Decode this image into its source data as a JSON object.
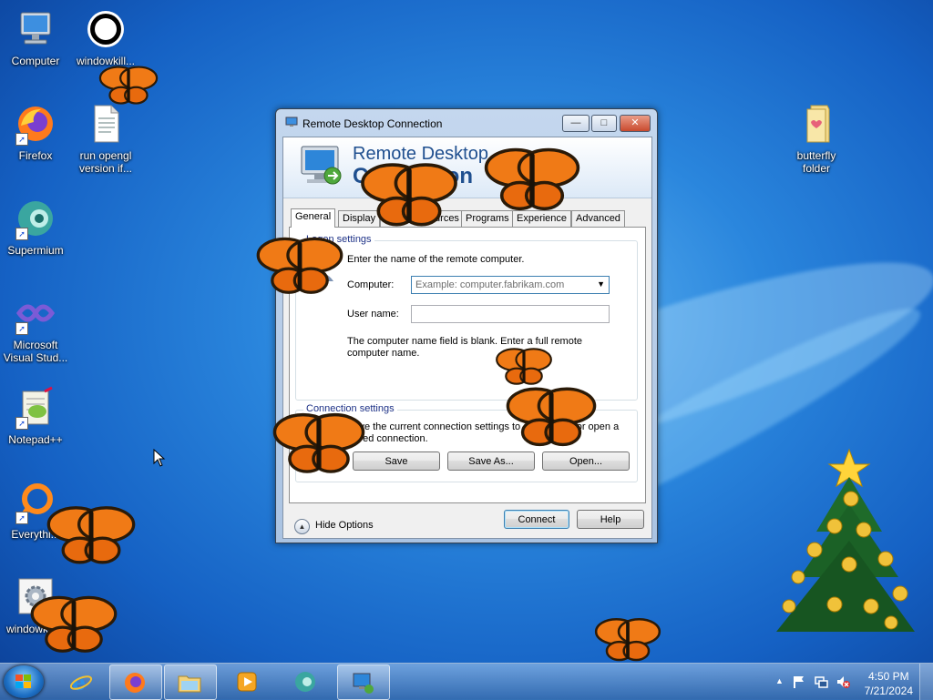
{
  "desktop": {
    "icons": [
      {
        "label": "Computer"
      },
      {
        "label": "windowkill..."
      },
      {
        "label": "Firefox"
      },
      {
        "label": "run opengl version if..."
      },
      {
        "label": "Supermium"
      },
      {
        "label": "Microsoft Visual Stud..."
      },
      {
        "label": "Notepad++"
      },
      {
        "label": "Everythi..."
      },
      {
        "label": "windowkill..."
      },
      {
        "label": "butterfly folder"
      }
    ]
  },
  "window": {
    "title": "Remote Desktop Connection",
    "banner_line1": "Remote Desktop",
    "banner_line2": "Connection",
    "tabs": [
      {
        "label": "General",
        "active": true
      },
      {
        "label": "Display"
      },
      {
        "label": "Local Resources"
      },
      {
        "label": "Programs"
      },
      {
        "label": "Experience"
      },
      {
        "label": "Advanced"
      }
    ],
    "logon": {
      "group_label": "Logon settings",
      "instruction": "Enter the name of the remote computer.",
      "computer_label": "Computer:",
      "computer_placeholder": "Example: computer.fabrikam.com",
      "username_label": "User name:",
      "username_value": "",
      "notice": "The computer name field is blank. Enter a full remote computer name."
    },
    "connection": {
      "group_label": "Connection settings",
      "text": "Save the current connection settings to an RDP file or open a saved connection.",
      "save": "Save",
      "save_as": "Save As...",
      "open": "Open..."
    },
    "hide_options": "Hide Options",
    "connect": "Connect",
    "help": "Help",
    "minimize_glyph": "—",
    "maximize_glyph": "□",
    "close_glyph": "✕"
  },
  "taskbar": {
    "items": [
      {
        "name": "Internet Explorer"
      },
      {
        "name": "Firefox"
      },
      {
        "name": "Windows Explorer"
      },
      {
        "name": "Windows Media Player"
      },
      {
        "name": "Supermium"
      },
      {
        "name": "Remote Desktop Connection",
        "open": true
      }
    ],
    "clock_time": "4:50 PM",
    "clock_date": "7/21/2024",
    "tray_chevron": "▲"
  },
  "colors": {
    "accent": "#1f4f8f",
    "butterfly": "#f07a16"
  }
}
